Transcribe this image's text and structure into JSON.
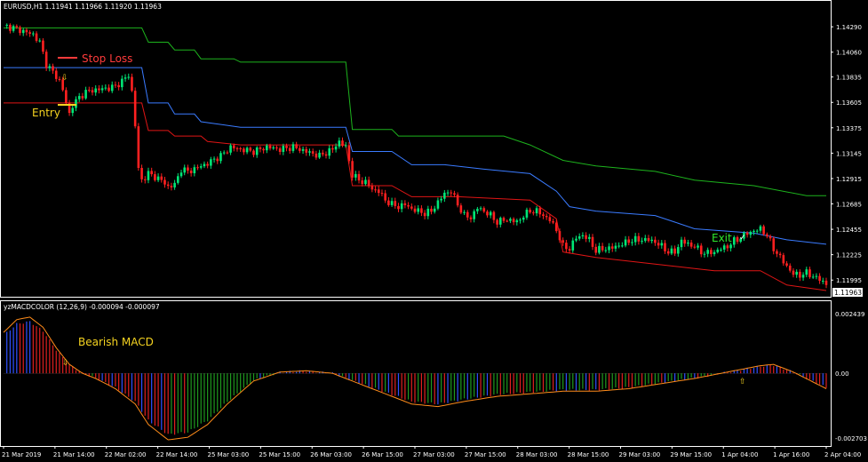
{
  "main_panel": {
    "header": "EURUSD,H1  1.11941 1.11966 1.11920 1.11963",
    "price_ticks": [
      "1.14290",
      "1.14060",
      "1.13835",
      "1.13605",
      "1.13375",
      "1.13145",
      "1.12915",
      "1.12685",
      "1.12455",
      "1.12225",
      "1.11995"
    ],
    "current_price": "1.11963",
    "annotations": {
      "stop_loss": "Stop Loss",
      "entry": "Entry",
      "exit": "Exit",
      "exit_mark": "✓",
      "entry_arrow": "⇩"
    }
  },
  "indicator_panel": {
    "header": "yzMACDCOLOR (12,26,9) -0.000094 -0.000097",
    "ticks": [
      "0.002439",
      "0.00",
      "-0.002703"
    ],
    "annotation": "Bearish MACD",
    "arrow_down": "⇩",
    "arrow_up": "⇧"
  },
  "time_axis": [
    "21 Mar 2019",
    "21 Mar 14:00",
    "22 Mar 02:00",
    "22 Mar 14:00",
    "25 Mar 03:00",
    "25 Mar 15:00",
    "26 Mar 03:00",
    "26 Mar 15:00",
    "27 Mar 03:00",
    "27 Mar 15:00",
    "28 Mar 03:00",
    "28 Mar 15:00",
    "29 Mar 03:00",
    "29 Mar 15:00",
    "1 Apr 04:00",
    "1 Apr 16:00",
    "2 Apr 04:00"
  ],
  "colors": {
    "background": "#000000",
    "bull": "#00e676",
    "bear": "#ff2020",
    "upper_band": "#1db31d",
    "mid_band": "#3a7bff",
    "lower_band": "#e01515",
    "macd_line": "#ff8c1a",
    "hist_blue": "#3050ff",
    "hist_green": "#1f9a1f",
    "hist_red": "#e02020",
    "stop_loss_text": "#ff3b3b",
    "annotation_yellow": "#f5d320",
    "exit_text": "#2ee82e"
  },
  "chart_data": [
    {
      "type": "candlestick",
      "title": "EURUSD,H1",
      "ylim": [
        1.1186,
        1.1442
      ],
      "close_path": [
        [
          0,
          1.143
        ],
        [
          3,
          1.1428
        ],
        [
          6,
          1.1425
        ],
        [
          9,
          1.1422
        ],
        [
          11,
          1.1415
        ],
        [
          13,
          1.1395
        ],
        [
          15,
          1.1388
        ],
        [
          17,
          1.138
        ],
        [
          18,
          1.1372
        ],
        [
          19,
          1.136
        ],
        [
          20,
          1.135
        ],
        [
          21,
          1.1358
        ],
        [
          23,
          1.1365
        ],
        [
          25,
          1.137
        ],
        [
          28,
          1.1372
        ],
        [
          31,
          1.1373
        ],
        [
          34,
          1.1375
        ],
        [
          36,
          1.138
        ],
        [
          38,
          1.1385
        ],
        [
          39,
          1.137
        ],
        [
          40,
          1.134
        ],
        [
          41,
          1.13
        ],
        [
          42,
          1.129
        ],
        [
          44,
          1.1296
        ],
        [
          46,
          1.1293
        ],
        [
          48,
          1.129
        ],
        [
          50,
          1.1284
        ],
        [
          52,
          1.1286
        ],
        [
          54,
          1.13
        ],
        [
          56,
          1.1298
        ],
        [
          58,
          1.13
        ],
        [
          60,
          1.1303
        ],
        [
          62,
          1.1305
        ],
        [
          64,
          1.1309
        ],
        [
          66,
          1.1312
        ],
        [
          69,
          1.132
        ],
        [
          72,
          1.1318
        ],
        [
          76,
          1.1316
        ],
        [
          80,
          1.132
        ],
        [
          84,
          1.1318
        ],
        [
          88,
          1.132
        ],
        [
          92,
          1.1316
        ],
        [
          96,
          1.1312
        ],
        [
          100,
          1.1318
        ],
        [
          102,
          1.1325
        ],
        [
          104,
          1.132
        ],
        [
          106,
          1.1295
        ],
        [
          108,
          1.129
        ],
        [
          110,
          1.1288
        ],
        [
          112,
          1.1282
        ],
        [
          114,
          1.128
        ],
        [
          116,
          1.1272
        ],
        [
          118,
          1.1268
        ],
        [
          120,
          1.1266
        ],
        [
          122,
          1.1268
        ],
        [
          124,
          1.1264
        ],
        [
          126,
          1.1262
        ],
        [
          128,
          1.126
        ],
        [
          130,
          1.1262
        ],
        [
          132,
          1.127
        ],
        [
          134,
          1.1278
        ],
        [
          136,
          1.128
        ],
        [
          138,
          1.1268
        ],
        [
          140,
          1.1258
        ],
        [
          142,
          1.1256
        ],
        [
          144,
          1.1265
        ],
        [
          146,
          1.1262
        ],
        [
          148,
          1.1258
        ],
        [
          150,
          1.1252
        ],
        [
          152,
          1.1254
        ],
        [
          154,
          1.1254
        ],
        [
          156,
          1.1252
        ],
        [
          158,
          1.1258
        ],
        [
          160,
          1.1262
        ],
        [
          162,
          1.1262
        ],
        [
          164,
          1.1258
        ],
        [
          166,
          1.1254
        ],
        [
          168,
          1.1245
        ],
        [
          170,
          1.123
        ],
        [
          172,
          1.1228
        ],
        [
          174,
          1.1238
        ],
        [
          176,
          1.124
        ],
        [
          178,
          1.1236
        ],
        [
          180,
          1.1226
        ],
        [
          182,
          1.1228
        ],
        [
          184,
          1.1228
        ],
        [
          186,
          1.123
        ],
        [
          188,
          1.1232
        ],
        [
          190,
          1.1235
        ],
        [
          192,
          1.1236
        ],
        [
          194,
          1.1236
        ],
        [
          196,
          1.1236
        ],
        [
          198,
          1.1234
        ],
        [
          200,
          1.123
        ],
        [
          202,
          1.1225
        ],
        [
          204,
          1.1225
        ],
        [
          206,
          1.1235
        ],
        [
          208,
          1.1232
        ],
        [
          210,
          1.123
        ],
        [
          212,
          1.1225
        ],
        [
          214,
          1.1224
        ],
        [
          216,
          1.1225
        ],
        [
          218,
          1.1228
        ],
        [
          220,
          1.123
        ],
        [
          222,
          1.1235
        ],
        [
          224,
          1.1238
        ],
        [
          226,
          1.1242
        ],
        [
          228,
          1.1244
        ],
        [
          230,
          1.1246
        ],
        [
          232,
          1.124
        ],
        [
          234,
          1.1228
        ],
        [
          236,
          1.122
        ],
        [
          238,
          1.1212
        ],
        [
          240,
          1.1205
        ],
        [
          242,
          1.1204
        ],
        [
          244,
          1.1206
        ],
        [
          246,
          1.1203
        ],
        [
          248,
          1.12
        ],
        [
          250,
          1.1196
        ]
      ],
      "upper_band": [
        [
          0,
          1.1428
        ],
        [
          42,
          1.1428
        ],
        [
          44,
          1.1415
        ],
        [
          50,
          1.1415
        ],
        [
          52,
          1.1408
        ],
        [
          58,
          1.1408
        ],
        [
          60,
          1.14
        ],
        [
          70,
          1.14
        ],
        [
          72,
          1.1397
        ],
        [
          104,
          1.1397
        ],
        [
          106,
          1.1336
        ],
        [
          118,
          1.1336
        ],
        [
          120,
          1.133
        ],
        [
          152,
          1.133
        ],
        [
          160,
          1.1322
        ],
        [
          170,
          1.1308
        ],
        [
          180,
          1.1303
        ],
        [
          198,
          1.1298
        ],
        [
          210,
          1.129
        ],
        [
          228,
          1.1285
        ],
        [
          244,
          1.1276
        ],
        [
          250,
          1.1276
        ]
      ],
      "mid_band": [
        [
          0,
          1.1392
        ],
        [
          42,
          1.1392
        ],
        [
          44,
          1.136
        ],
        [
          50,
          1.136
        ],
        [
          52,
          1.135
        ],
        [
          58,
          1.135
        ],
        [
          60,
          1.1343
        ],
        [
          72,
          1.1338
        ],
        [
          104,
          1.1338
        ],
        [
          106,
          1.1316
        ],
        [
          118,
          1.1316
        ],
        [
          124,
          1.1304
        ],
        [
          134,
          1.1304
        ],
        [
          146,
          1.13
        ],
        [
          160,
          1.1296
        ],
        [
          168,
          1.128
        ],
        [
          172,
          1.1266
        ],
        [
          180,
          1.1262
        ],
        [
          198,
          1.1258
        ],
        [
          204,
          1.1252
        ],
        [
          210,
          1.1246
        ],
        [
          228,
          1.1242
        ],
        [
          238,
          1.1236
        ],
        [
          250,
          1.1232
        ]
      ],
      "lower_band": [
        [
          0,
          1.136
        ],
        [
          42,
          1.136
        ],
        [
          44,
          1.1335
        ],
        [
          50,
          1.1335
        ],
        [
          52,
          1.133
        ],
        [
          60,
          1.133
        ],
        [
          62,
          1.1325
        ],
        [
          72,
          1.1322
        ],
        [
          104,
          1.1322
        ],
        [
          106,
          1.1285
        ],
        [
          118,
          1.1285
        ],
        [
          124,
          1.1275
        ],
        [
          130,
          1.1275
        ],
        [
          138,
          1.1275
        ],
        [
          160,
          1.1272
        ],
        [
          168,
          1.1255
        ],
        [
          170,
          1.1225
        ],
        [
          180,
          1.122
        ],
        [
          198,
          1.1214
        ],
        [
          204,
          1.1212
        ],
        [
          210,
          1.121
        ],
        [
          216,
          1.1208
        ],
        [
          230,
          1.1208
        ],
        [
          238,
          1.1195
        ],
        [
          250,
          1.119
        ]
      ],
      "current_price": 1.11963
    },
    {
      "type": "bar",
      "title": "yzMACDCOLOR (12,26,9)",
      "ylim": [
        -0.002703,
        0.002439
      ],
      "macd_signal_path": [
        [
          0,
          0.0016
        ],
        [
          4,
          0.0021
        ],
        [
          8,
          0.0022
        ],
        [
          12,
          0.0018
        ],
        [
          16,
          0.001
        ],
        [
          20,
          0.00035
        ],
        [
          24,
          0.0
        ],
        [
          28,
          -0.0002
        ],
        [
          34,
          -0.0006
        ],
        [
          40,
          -0.0012
        ],
        [
          44,
          -0.002
        ],
        [
          50,
          -0.0026
        ],
        [
          56,
          -0.0025
        ],
        [
          62,
          -0.002
        ],
        [
          68,
          -0.0012
        ],
        [
          76,
          -0.0003
        ],
        [
          84,
          5e-05
        ],
        [
          92,
          0.0001
        ],
        [
          100,
          0.0
        ],
        [
          108,
          -0.0004
        ],
        [
          116,
          -0.0008
        ],
        [
          124,
          -0.0012
        ],
        [
          132,
          -0.0013
        ],
        [
          140,
          -0.0011
        ],
        [
          150,
          -0.0009
        ],
        [
          160,
          -0.0008
        ],
        [
          170,
          -0.0007
        ],
        [
          180,
          -0.0007
        ],
        [
          190,
          -0.0006
        ],
        [
          200,
          -0.0004
        ],
        [
          210,
          -0.0002
        ],
        [
          222,
          0.0001
        ],
        [
          230,
          0.0003
        ],
        [
          234,
          0.00035
        ],
        [
          240,
          5e-05
        ],
        [
          250,
          -0.0006
        ]
      ],
      "histogram_scale": 0.85
    }
  ]
}
